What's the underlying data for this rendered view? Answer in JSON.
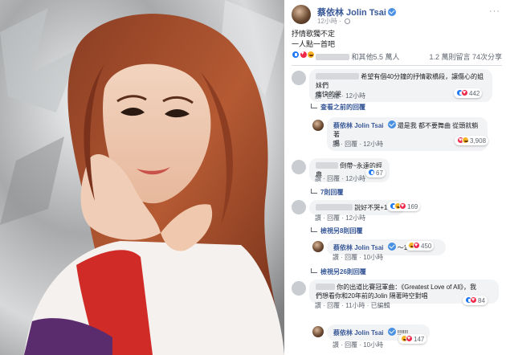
{
  "post": {
    "author": "蔡依林 Jolin Tsai",
    "time": "12小時",
    "menu": "···",
    "text_line1": "抒情歌獨不定",
    "text_line2": "一人點一首吧",
    "reactions_summary": "和其他5.5 萬人",
    "stats": "1.2 萬則留言  74次分享"
  },
  "comments": [
    {
      "text_line1": "希望有個40分鐘的抒情歌橋段，讓傷心的姐妹們",
      "text_line2": "痛快的哭",
      "actions": "讚 · 回覆 · 12小時",
      "reaction_count": "442"
    },
    {
      "reply_link": "查看之前的回覆"
    },
    {
      "author": "蔡依林 Jolin Tsai",
      "text_line1": "還是我 都不要舞曲 從頭就躺著",
      "text_line2": "唱",
      "actions": "讚 · 回覆 · 12小時",
      "reaction_count": "3,908"
    },
    {
      "text_line1": "倒帶~永遠的經典",
      "actions": "讚 · 回覆 · 12小時",
      "reaction_count": "67"
    },
    {
      "reply_link": "7則回覆"
    },
    {
      "text_line1": "說好不哭+1",
      "actions": "讚 · 回覆 · 12小時",
      "reaction_count": "169"
    },
    {
      "reply_link": "檢視另8則回覆"
    },
    {
      "author": "蔡依林 Jolin Tsai",
      "text_line1": "～1",
      "actions": "讚 · 回覆 · 10小時",
      "reaction_count": "450"
    },
    {
      "reply_link": "檢視另26則回覆"
    },
    {
      "text_line1": "你的出道比賽冠軍曲：《Greatest Love of All》，我",
      "text_line2": "們想看你和20年前的Jolin 隔著時空對唱",
      "actions": "讚 · 回覆 · 11小時 · 已編輯",
      "reaction_count": "84"
    },
    {
      "author": "蔡依林 Jolin Tsai",
      "text_line1": "!!!!!!",
      "actions": "讚 · 回覆 · 10小時",
      "reaction_count": "147"
    }
  ]
}
